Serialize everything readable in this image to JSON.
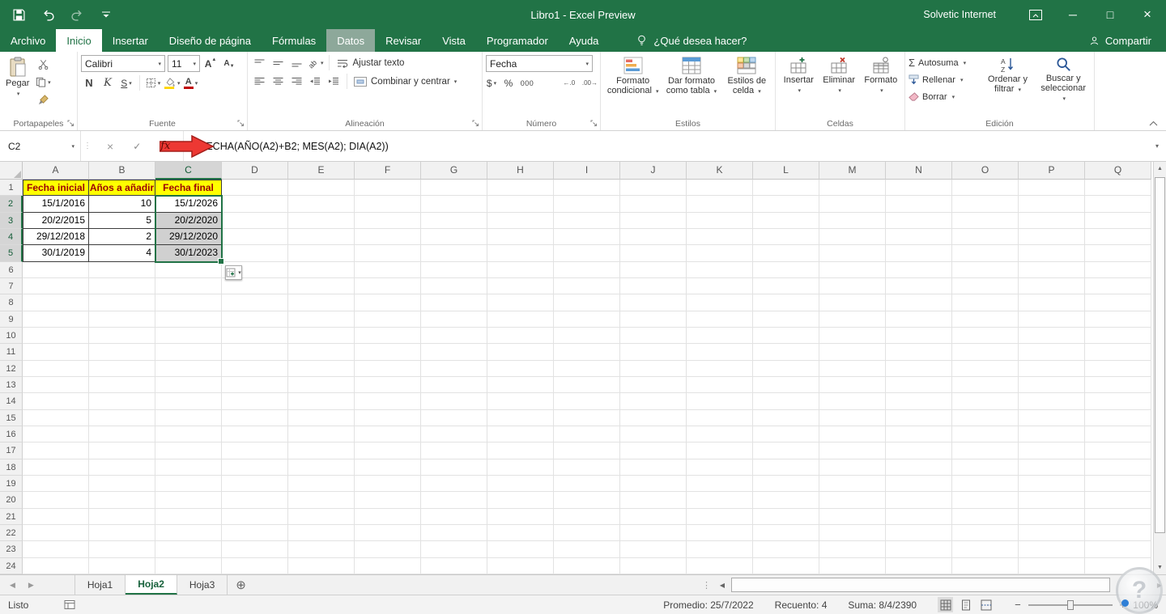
{
  "window": {
    "title": "Libro1 - Excel Preview",
    "account": "Solvetic Internet"
  },
  "ribbon": {
    "tabs": [
      {
        "label": "Archivo",
        "state": "file"
      },
      {
        "label": "Inicio",
        "state": "active"
      },
      {
        "label": "Insertar"
      },
      {
        "label": "Diseño de página"
      },
      {
        "label": "Fórmulas"
      },
      {
        "label": "Datos",
        "state": "highlight"
      },
      {
        "label": "Revisar"
      },
      {
        "label": "Vista"
      },
      {
        "label": "Programador"
      },
      {
        "label": "Ayuda"
      }
    ],
    "tell_me": "¿Qué desea hacer?",
    "share": "Compartir"
  },
  "groups": {
    "clipboard": {
      "label": "Portapapeles",
      "paste": "Pegar"
    },
    "font": {
      "label": "Fuente",
      "family": "Calibri",
      "size": "11",
      "bold": "N",
      "italic": "K",
      "underline": "S"
    },
    "alignment": {
      "label": "Alineación",
      "wrap_text": "Ajustar texto",
      "merge_center": "Combinar y centrar"
    },
    "number": {
      "label": "Número",
      "format": "Fecha",
      "currency": "$",
      "percent": "%",
      "thousands": "000",
      "inc_decimal": "←.0",
      "dec_decimal": ".00→"
    },
    "styles": {
      "label": "Estilos",
      "conditional": "Formato condicional",
      "as_table": "Dar formato como tabla",
      "cell_styles": "Estilos de celda"
    },
    "cells": {
      "label": "Celdas",
      "insert": "Insertar",
      "delete": "Eliminar",
      "format": "Formato"
    },
    "editing": {
      "label": "Edición",
      "autosum": "Autosuma",
      "fill": "Rellenar",
      "clear": "Borrar",
      "sort": "Ordenar y filtrar",
      "find": "Buscar y seleccionar"
    }
  },
  "formula_bar": {
    "name_box": "C2",
    "fx": "fx",
    "formula": "=FECHA(AÑO(A2)+B2; MES(A2); DIA(A2))"
  },
  "grid": {
    "columns": [
      "A",
      "B",
      "C",
      "D",
      "E",
      "F",
      "G",
      "H",
      "I",
      "J",
      "K",
      "L",
      "M",
      "N",
      "O",
      "P",
      "Q"
    ],
    "row_count": 24,
    "selected_column": "C",
    "selected_rows": [
      2,
      3,
      4,
      5
    ],
    "active_cell": "C2",
    "header_row": {
      "A": "Fecha inicial",
      "B": "Años a añadir",
      "C": "Fecha final"
    },
    "data_rows": [
      {
        "A": "15/1/2016",
        "B": "10",
        "C": "15/1/2026"
      },
      {
        "A": "20/2/2015",
        "B": "5",
        "C": "20/2/2020"
      },
      {
        "A": "29/12/2018",
        "B": "2",
        "C": "29/12/2020"
      },
      {
        "A": "30/1/2019",
        "B": "4",
        "C": "30/1/2023"
      }
    ]
  },
  "sheet_tabs": {
    "tabs": [
      {
        "label": "Hoja1",
        "active": false
      },
      {
        "label": "Hoja2",
        "active": true
      },
      {
        "label": "Hoja3",
        "active": false
      }
    ]
  },
  "status_bar": {
    "mode": "Listo",
    "average": "Promedio: 25/7/2022",
    "count": "Recuento: 4",
    "sum": "Suma: 8/4/2390",
    "zoom": "100%"
  },
  "icons": {
    "save": "floppy",
    "undo": "↺",
    "redo": "↻",
    "cut": "scissors",
    "copy": "pages",
    "format_painter": "brush",
    "lightbulb": "bulb",
    "share": "person",
    "minimize": "─",
    "maximize": "□",
    "close": "×",
    "dropdown": "▾",
    "cancel": "×",
    "enter": "✓",
    "new_sheet": "⊕"
  },
  "colors": {
    "excel_green": "#217346",
    "header_yellow": "#ffff00",
    "header_text_red": "#9c0006",
    "selection_gray": "#d0d0d0",
    "annotation_red": "#ed3833"
  }
}
